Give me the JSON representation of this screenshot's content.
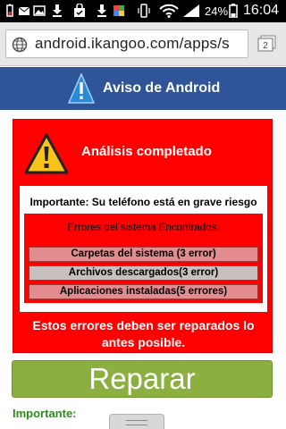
{
  "status_bar": {
    "battery_percent": "24%",
    "time": "16:04",
    "icons": [
      "battery-small-icon",
      "mail-icon",
      "image-icon",
      "download-icon",
      "shopping-bag-icon",
      "download-icon",
      "app-icon",
      "vibrate-icon",
      "wifi-icon",
      "signal-icon",
      "battery-icon"
    ]
  },
  "browser": {
    "url": "android.ikangoo.com/apps/s",
    "tab_count": "2"
  },
  "header": {
    "title": "Aviso de Android"
  },
  "alert": {
    "title": "Análisis completado",
    "important_text": "Importante: Su teléfono está en grave riesgo",
    "errors_header": "Errores del sistema Encontrados:",
    "errors": [
      {
        "label": "Carpetas del sistema (3 error)",
        "color": "#e28c90"
      },
      {
        "label": "Archivos descargados(3 error)",
        "color": "#c7c0be"
      },
      {
        "label": "Aplicaciones instaladas(5 errores)",
        "color": "#e28c90"
      }
    ],
    "footer_line1": "Estos errores deben ser reparados lo",
    "footer_line2": "antes posible."
  },
  "repair_button": {
    "label": "Reparar",
    "color": "#8cb03f"
  },
  "important_label": "Importante:",
  "colors": {
    "header_bg": "#2f5598",
    "panel_bg": "#ff0000",
    "important_green": "#2e8b1e"
  }
}
